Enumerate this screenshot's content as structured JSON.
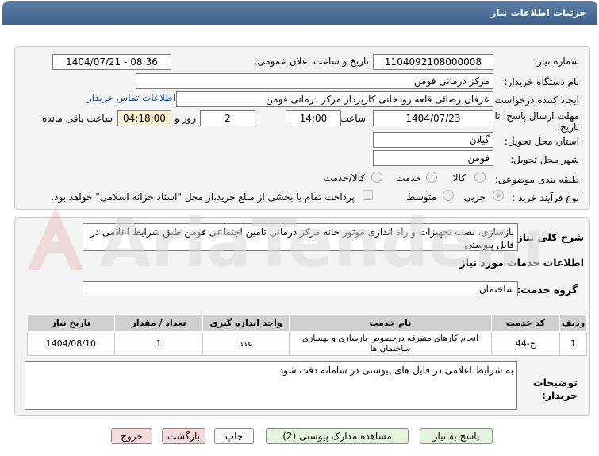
{
  "header": {
    "title": "جزئیات اطلاعات نیاز"
  },
  "details": {
    "need_number_label": "شماره نیاز:",
    "need_number": "1104092108000008",
    "announce_label": "تاریخ و ساعت اعلان عمومی:",
    "announce_value": "1404/07/21 - 08:36",
    "buyer_org_label": "نام دستگاه خریدار:",
    "buyer_org": "مرکز درمانی فومن",
    "creator_label": "ایجاد کننده درخواست:",
    "creator": "عرفان رضائی قلعه رودخانی کارپرداز مرکز درمانی فومن",
    "contact_link": "اطلاعات تماس خریدار",
    "deadline_label_1": "مهلت ارسال پاسخ: تا",
    "deadline_label_2": "تاریخ:",
    "deadline_date": "1404/07/23",
    "time_label": "ساعت",
    "deadline_time": "14:00",
    "days_value": "2",
    "days_label": "روز و",
    "remaining_time": "04:18:00",
    "remaining_label": "ساعت باقی مانده",
    "province_label": "استان محل تحویل:",
    "province": "گیلان",
    "city_label": "شهر محل تحویل:",
    "city": "فومن",
    "category_label": "طبقه بندی موضوعی:",
    "category_options": [
      "کالا",
      "خدمت",
      "کالا/خدمت"
    ],
    "process_label": "نوع فرآیند خرید :",
    "process_options": [
      "جزیی",
      "متوسط"
    ],
    "payment_note": "پرداخت تمام یا بخشی از مبلغ خرید،از محل \"اسناد خزانه اسلامی\" خواهد بود."
  },
  "need": {
    "summary_label": "شرح کلی نیاز:",
    "summary": "بازسازی، نصب تجهیزات و راه اندازی موتور خانه مرکز درمانی تامین اجتماعی فومن طبق شرایط اعلامی در فایل پیوستی",
    "services_title": "اطلاعات خدمات مورد نیاز",
    "group_label": "گروه خدمت:",
    "group_value": "ساختمان"
  },
  "table": {
    "headers": [
      "ردیف",
      "کد خدمت",
      "نام خدمت",
      "واحد اندازه گیری",
      "تعداد / مقدار",
      "تاریخ نیاز"
    ],
    "rows": [
      [
        "1",
        "ج-44",
        "انجام کارهای متفرقه درخصوص بازسازی و بهسازی ساختمان ها",
        "عدد",
        "1",
        "1404/08/10"
      ]
    ]
  },
  "notes": {
    "label_1": "توضیحات",
    "label_2": "خریدار:",
    "text": "به شرایط اعلامی در فایل های پیوستی در سامانه دقت شود"
  },
  "buttons": {
    "reply": "پاسخ به نیاز",
    "attachments": "مشاهده مدارک پیوستی (2)",
    "print": "چاپ",
    "back": "بازگشت",
    "exit": "خروج"
  },
  "watermark": {
    "text": "AriaTender.net"
  },
  "colors": {
    "titlebar": "#4a6d96",
    "panel": "#f4f4f4",
    "link": "#1a4f9c",
    "time_bg": "#fbf0d0",
    "btn_green": "#e4f5de",
    "btn_pink": "#f8dada"
  }
}
